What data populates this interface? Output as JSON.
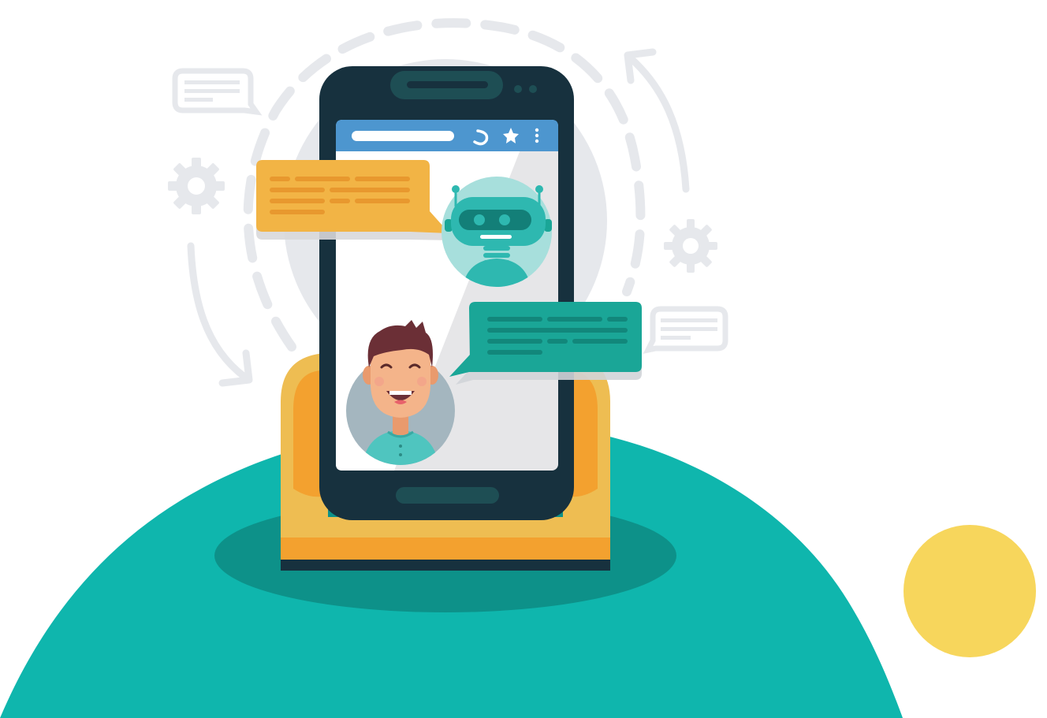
{
  "illustration": {
    "subject": "chatbot-conversation-on-smartphone",
    "colors": {
      "background": "#ffffff",
      "hill": "#0fb6ad",
      "hill_shadow": "#0d9189",
      "sun": "#f7d65c",
      "stand_orange": "#f3a12f",
      "stand_yellow": "#eebd52",
      "phone_body": "#17313e",
      "phone_rim": "#1e4e54",
      "screen": "#e6e6e8",
      "screen_header": "#4d96cf",
      "bot_bubble": "#f2b445",
      "bot_bubble_lines": "#e8982e",
      "user_bubble": "#1aa697",
      "user_bubble_lines": "#12877b",
      "robot_head": "#2eb8b0",
      "robot_circle_bg": "#a7dfdc",
      "user_circle_bg": "#a4b6bf",
      "deco_grey": "#e6e8ec"
    },
    "icons": {
      "phone": "phone-icon",
      "star": "star-icon",
      "menu": "more-vertical-icon",
      "gear": "gear-icon",
      "note": "note-icon"
    }
  }
}
